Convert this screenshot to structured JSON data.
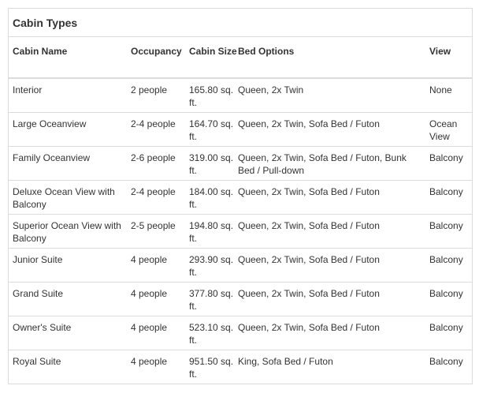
{
  "title": "Cabin Types",
  "columns": {
    "name": "Cabin Name",
    "occupancy": "Occupancy",
    "size": "Cabin Size",
    "beds": "Bed Options",
    "view": "View"
  },
  "rows": [
    {
      "name": "Interior",
      "occupancy": "2 people",
      "size": "165.80 sq. ft.",
      "beds": "Queen, 2x Twin",
      "view": "None"
    },
    {
      "name": "Large Oceanview",
      "occupancy": "2-4 people",
      "size": "164.70 sq. ft.",
      "beds": "Queen, 2x Twin, Sofa Bed / Futon",
      "view": "Ocean View"
    },
    {
      "name": "Family Oceanview",
      "occupancy": "2-6 people",
      "size": "319.00 sq. ft.",
      "beds": "Queen, 2x Twin, Sofa Bed / Futon, Bunk Bed / Pull-down",
      "view": "Balcony"
    },
    {
      "name": "Deluxe Ocean View with Balcony",
      "occupancy": "2-4 people",
      "size": "184.00 sq. ft.",
      "beds": "Queen, 2x Twin, Sofa Bed / Futon",
      "view": "Balcony"
    },
    {
      "name": "Superior Ocean View with Balcony",
      "occupancy": "2-5 people",
      "size": "194.80 sq. ft.",
      "beds": "Queen, 2x Twin, Sofa Bed / Futon",
      "view": "Balcony"
    },
    {
      "name": "Junior Suite",
      "occupancy": "4 people",
      "size": "293.90 sq. ft.",
      "beds": "Queen, 2x Twin, Sofa Bed / Futon",
      "view": "Balcony"
    },
    {
      "name": "Grand Suite",
      "occupancy": "4 people",
      "size": "377.80 sq. ft.",
      "beds": "Queen, 2x Twin, Sofa Bed / Futon",
      "view": "Balcony"
    },
    {
      "name": "Owner's Suite",
      "occupancy": "4 people",
      "size": "523.10 sq. ft.",
      "beds": "Queen, 2x Twin, Sofa Bed / Futon",
      "view": "Balcony"
    },
    {
      "name": "Royal Suite",
      "occupancy": "4 people",
      "size": "951.50 sq. ft.",
      "beds": "King, Sofa Bed / Futon",
      "view": "Balcony"
    }
  ]
}
